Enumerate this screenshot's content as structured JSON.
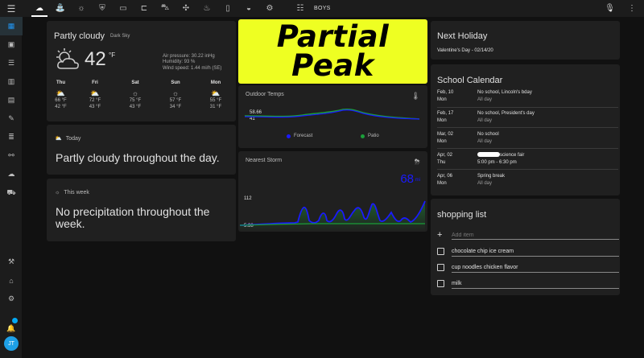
{
  "topbar": {
    "tabs": [
      "cloud-icon",
      "sprinkler-icon",
      "lightbulb-icon",
      "shield-icon",
      "monitor-icon",
      "cast-icon",
      "car-icon",
      "fan-icon",
      "heater-icon",
      "trash-icon",
      "bowl-icon",
      "settings-cog-icon"
    ],
    "label_tab_icon": "chart-icon",
    "label_tab_text": "BOYS"
  },
  "sidebar": {
    "items": [
      "grid-icon",
      "account-box-icon",
      "list-icon",
      "chart-box-icon",
      "calendar-box-icon",
      "wrench-icon",
      "layers-icon",
      "sitemap-icon",
      "cloud-icon",
      "cart-icon"
    ],
    "bottom": [
      "hammer-icon",
      "home-cog-icon",
      "gear-icon"
    ],
    "avatar_initials": "JT"
  },
  "weather": {
    "title": "Partly cloudy",
    "source": "Dark Sky",
    "temp": "42",
    "unit": "°F",
    "pressure": "Air pressure: 30.22 inHg",
    "humidity": "Humidity: 93 %",
    "wind": "Wind speed: 1.44 mi/h (SE)",
    "forecast": [
      {
        "day": "Thu",
        "icon": "partly-cloudy-icon",
        "high": "66 °F",
        "low": "42 °F"
      },
      {
        "day": "Fri",
        "icon": "partly-cloudy-icon",
        "high": "72 °F",
        "low": "43 °F"
      },
      {
        "day": "Sat",
        "icon": "sunny-icon",
        "high": "75 °F",
        "low": "43 °F"
      },
      {
        "day": "Sun",
        "icon": "sunny-icon",
        "high": "57 °F",
        "low": "34 °F"
      },
      {
        "day": "Mon",
        "icon": "partly-cloudy-icon",
        "high": "55 °F",
        "low": "31 °F"
      }
    ]
  },
  "today": {
    "heading": "Today",
    "text": "Partly cloudy throughout the day."
  },
  "week": {
    "heading": "This week",
    "text": "No precipitation throughout the week."
  },
  "peak": {
    "line1": "Partial",
    "line2": "Peak",
    "bg": "#eeff22"
  },
  "outdoor": {
    "title": "Outdoor Temps",
    "label_hi": "58.66",
    "label_lo": "41",
    "legend": [
      {
        "name": "Forecast",
        "color": "#1a1aff"
      },
      {
        "name": "Patio",
        "color": "#1b9e3a"
      }
    ]
  },
  "storm": {
    "title": "Nearest Storm",
    "value": "68",
    "unit": "mi",
    "label_hi": "112",
    "label_lo": "5.38"
  },
  "holiday": {
    "title": "Next Holiday",
    "value": "Valentine's Day - 02/14/20"
  },
  "calendar": {
    "title": "School Calendar",
    "events": [
      {
        "date": "Feb, 10",
        "day": "Mon",
        "title": "No school, Lincoln's bday",
        "time": "All day"
      },
      {
        "date": "Feb, 17",
        "day": "Mon",
        "title": "No school, President's day",
        "time": "All day"
      },
      {
        "date": "Mar, 02",
        "day": "Mon",
        "title": "No school",
        "time": "All day"
      },
      {
        "date": "Apr, 02",
        "day": "Thu",
        "title": "science fair",
        "time": "5:00 pm - 6:30 pm"
      },
      {
        "date": "Apr, 06",
        "day": "Mon",
        "title": "Spring break",
        "time": "All day"
      }
    ]
  },
  "shopping": {
    "title": "shopping list",
    "placeholder": "Add item",
    "items": [
      "chocolate chip ice cream",
      "cup noodles chicken flavor",
      "milk"
    ]
  }
}
